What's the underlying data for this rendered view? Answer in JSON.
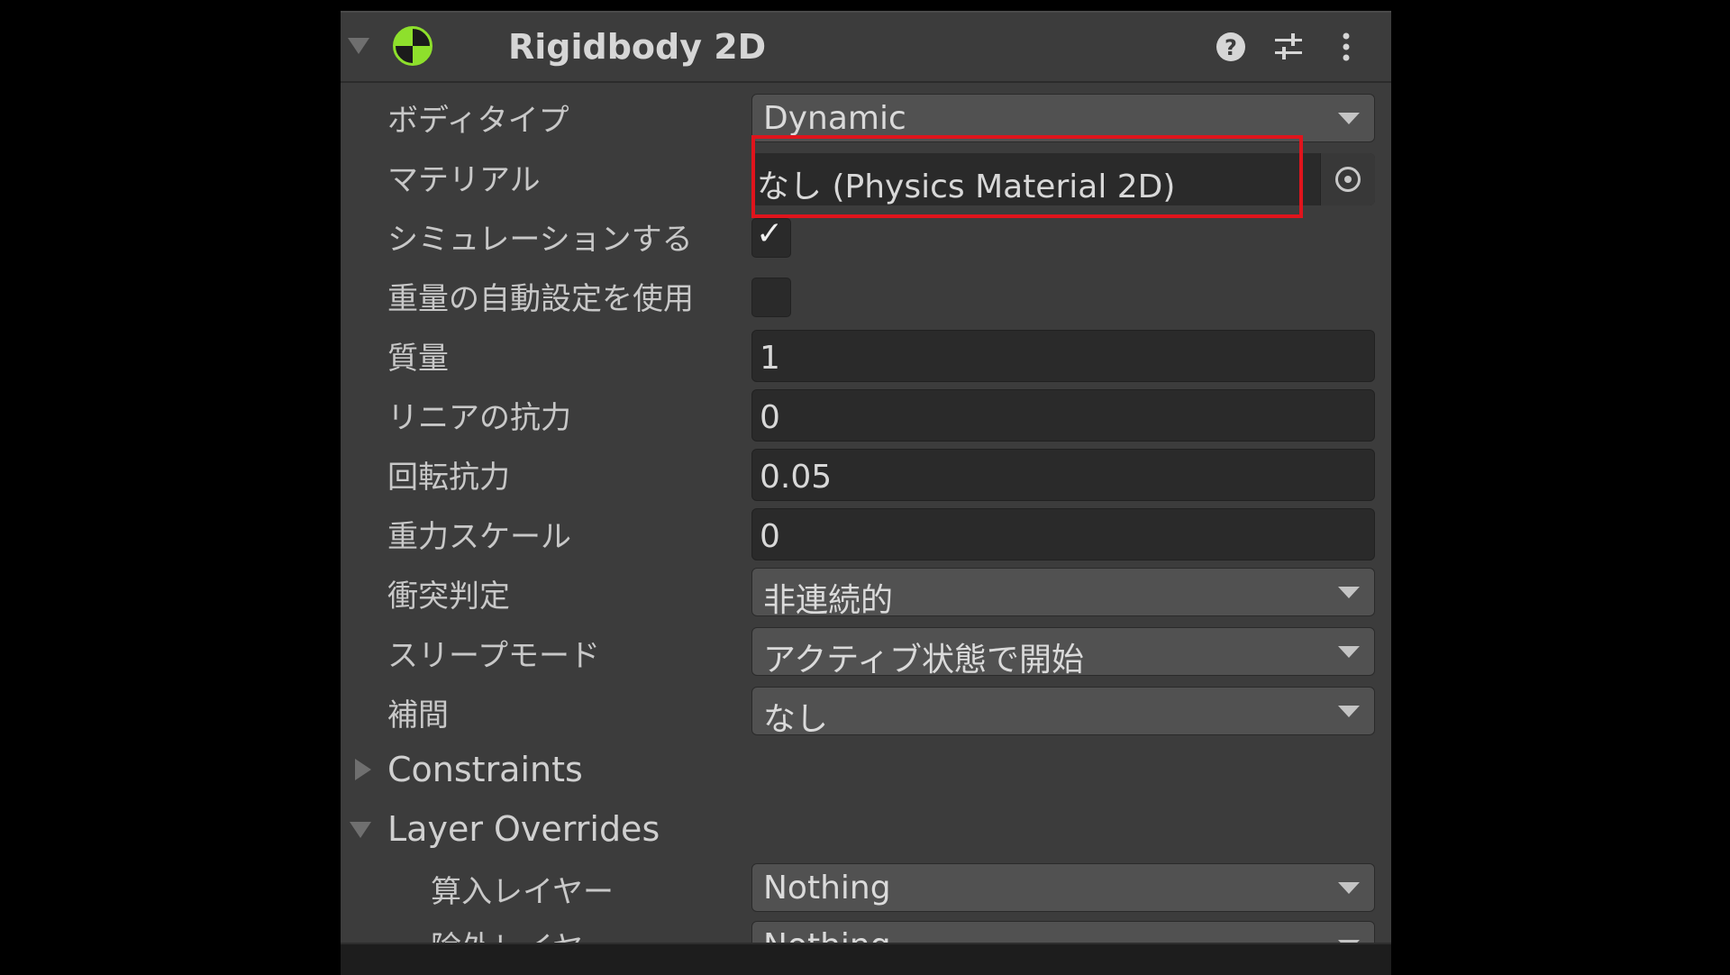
{
  "component": {
    "title": "Rigidbody 2D",
    "icons": [
      "help-icon",
      "preset-icon",
      "more-icon"
    ]
  },
  "fields": {
    "body_type_label": "ボディタイプ",
    "body_type_value": "Dynamic",
    "material_label": "マテリアル",
    "material_value": "なし (Physics Material 2D)",
    "simulated_label": "シミュレーションする",
    "simulated_checked": true,
    "auto_mass_label": "重量の自動設定を使用",
    "auto_mass_checked": false,
    "mass_label": "質量",
    "mass_value": "1",
    "linear_drag_label": "リニアの抗力",
    "linear_drag_value": "0",
    "angular_drag_label": "回転抗力",
    "angular_drag_value": "0.05",
    "gravity_scale_label": "重力スケール",
    "gravity_scale_value": "0",
    "collision_detection_label": "衝突判定",
    "collision_detection_value": "非連続的",
    "sleep_mode_label": "スリープモード",
    "sleep_mode_value": "アクティブ状態で開始",
    "interpolate_label": "補間",
    "interpolate_value": "なし"
  },
  "sections": {
    "constraints_label": "Constraints",
    "layer_overrides_label": "Layer Overrides",
    "include_layers_label": "算入レイヤー",
    "include_layers_value": "Nothing",
    "exclude_layers_label": "除外レイヤ",
    "exclude_layers_value": "Nothing"
  },
  "colors": {
    "panel_bg": "#3c3c3c",
    "highlight_box": "#e0141c",
    "rigidbody_icon": "#8ee02c"
  }
}
